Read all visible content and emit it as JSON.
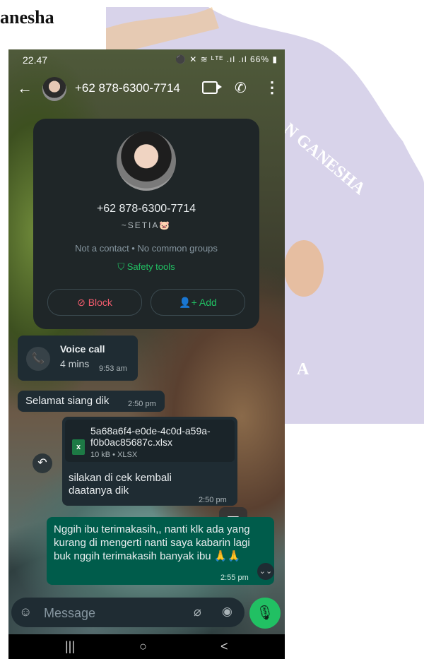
{
  "document": {
    "heading": "anesha",
    "seal_lines": [
      "N GANESHA",
      "A"
    ]
  },
  "status_bar": {
    "time": "22.47",
    "icons": "⚫ ✕ ≋ ᴸᵀᴱ .ıl .ıl",
    "battery": "66%"
  },
  "header": {
    "title": "+62 878-6300-7714",
    "back": "←",
    "call": "✆",
    "more": "⋮"
  },
  "contact_card": {
    "phone": "+62 878-6300-7714",
    "nickname": "~SETIA🐷",
    "info": "Not a contact • No common groups",
    "safety": "Safety tools",
    "safety_icon": "⛉",
    "block_label": "Block",
    "block_icon": "⊘",
    "add_label": "Add",
    "add_icon": "👤+"
  },
  "messages": {
    "voice_call": {
      "title": "Voice call",
      "duration": "4 mins",
      "time": "9:53 am",
      "icon": "📞"
    },
    "greeting": {
      "text": "Selamat siang dik",
      "time": "2:50 pm"
    },
    "file": {
      "name": "5a68a6f4-e0de-4c0d-a59a-f0b0ac85687c.xlsx",
      "meta": "10 kB • XLSX",
      "icon_letter": "x",
      "caption": "silakan di cek kembali daatanya dik",
      "time": "2:50 pm"
    },
    "reply": {
      "text": "Nggih ibu terimakasih,, nanti klk ada yang kurang di mengerti nanti saya kabarin lagi buk nggih terimakasih banyak ibu 🙏🙏",
      "time": "2:55 pm"
    }
  },
  "controls": {
    "reply_icon": "↶",
    "scan_icon": "▣",
    "scroll_icon": "⌄⌄"
  },
  "input": {
    "placeholder": "Message",
    "emoji": "☺",
    "attach": "⌀",
    "camera": "◉",
    "mic": "🎙"
  },
  "navbar": {
    "recent": "|||",
    "home": "○",
    "back": "<"
  },
  "colors": {
    "accent_green": "#21c063",
    "sent_bubble": "#005c4b",
    "received_bubble": "#1f2c33",
    "block_red": "#f15c6d"
  }
}
